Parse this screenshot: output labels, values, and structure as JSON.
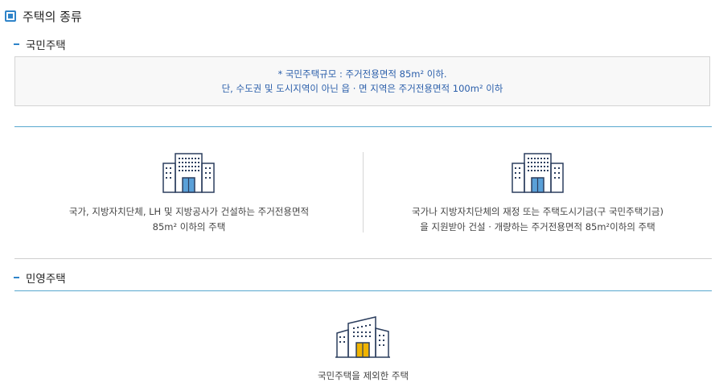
{
  "page": {
    "title": "주택의 종류"
  },
  "national": {
    "heading": "국민주택",
    "notice_line1": "* 국민주택규모 : 주거전용면적 85m² 이하.",
    "notice_line2": "단, 수도권 및 도시지역이 아닌 읍 · 면 지역은 주거전용면적 100m² 이하",
    "left": {
      "icon": "apartment-building-icon",
      "line1": "국가, 지방자치단체, LH 및 지방공사가 건설하는 주거전용면적",
      "line2": "85m² 이하의 주택"
    },
    "right": {
      "icon": "apartment-building-icon",
      "line1": "국가나 지방자치단체의 재정 또는 주택도시기금(구 국민주택기금)",
      "line2": "을 지원받아 건설 · 개량하는 주거전용면적 85m²이하의 주택"
    }
  },
  "private": {
    "heading": "민영주택",
    "icon": "apartment-building-icon",
    "line1": "국민주택을 제외한 주택"
  },
  "colors": {
    "accent": "#2f84c9",
    "notice_text": "#2a5eaa",
    "door_blue": "#5aa0d8",
    "door_yellow": "#f0b400"
  }
}
